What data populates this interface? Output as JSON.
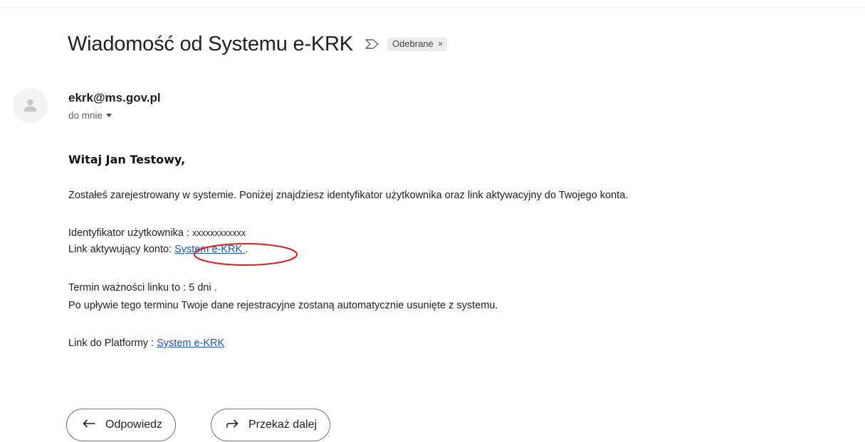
{
  "email": {
    "subject": "Wiadomość od Systemu e-KRK",
    "important_icon": "importance-marker-icon",
    "label": "Odebrane",
    "label_close": "×",
    "sender": "ekrk@ms.gov.pl",
    "recipient": "do mnie",
    "avatar_icon": "person-icon"
  },
  "body": {
    "greeting": "Witaj  Jan Testowy,",
    "intro": "Zostałeś zarejestrowany w systemie. Poniżej znajdziesz identyfikator użytkownika oraz link aktywacyjny do Twojego konta.",
    "user_id_label": "Identyfikator użytkownika :  ",
    "user_id_value": "xxxxxxxxxxxx",
    "activation_label": "Link aktywujący konto",
    "activation_sep": ": ",
    "activation_link": "System e-KRK ",
    "activation_end": ".",
    "validity": "Termin ważności linku to : 5 dni .",
    "expiry_note": "Po upływie tego terminu Twoje dane rejestracyjne zostaną automatycznie usunięte z systemu.",
    "platform_label": "Link do Platformy : ",
    "platform_link": "System e-KRK"
  },
  "actions": {
    "reply": "Odpowiedz",
    "reply_icon": "reply-icon",
    "forward": "Przekaż dalej",
    "forward_icon": "forward-icon"
  },
  "colors": {
    "link": "#1a55b5",
    "highlight_circle": "#d21f1f"
  }
}
